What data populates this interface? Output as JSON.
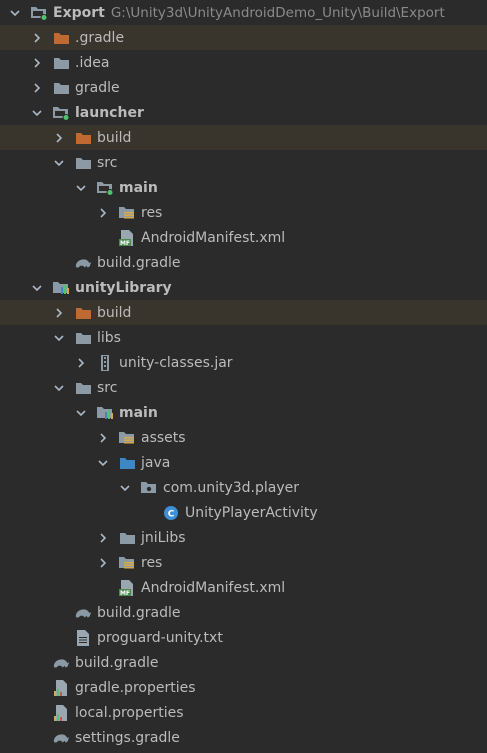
{
  "tree": [
    {
      "label": "Export",
      "path": "G:\\Unity3d\\UnityAndroidDemo_Unity\\Build\\Export",
      "icon": "module-folder-icon",
      "expanded": true,
      "depth": 0,
      "bold": true
    },
    {
      "label": ".gradle",
      "icon": "excluded-folder-icon",
      "expanded": false,
      "depth": 1,
      "highlight": true
    },
    {
      "label": ".idea",
      "icon": "folder-icon",
      "expanded": false,
      "depth": 1
    },
    {
      "label": "gradle",
      "icon": "folder-icon",
      "expanded": false,
      "depth": 1
    },
    {
      "label": "launcher",
      "icon": "module-folder-icon",
      "expanded": true,
      "depth": 1,
      "bold": true
    },
    {
      "label": "build",
      "icon": "excluded-folder-icon",
      "expanded": false,
      "depth": 2,
      "highlight": true
    },
    {
      "label": "src",
      "icon": "folder-icon",
      "expanded": true,
      "depth": 2
    },
    {
      "label": "main",
      "icon": "module-folder-icon",
      "expanded": true,
      "depth": 3,
      "bold": true
    },
    {
      "label": "res",
      "icon": "resources-folder-icon",
      "expanded": false,
      "depth": 4
    },
    {
      "label": "AndroidManifest.xml",
      "icon": "manifest-file-icon",
      "depth": 4,
      "leaf": true
    },
    {
      "label": "build.gradle",
      "icon": "gradle-file-icon",
      "depth": 2,
      "leaf": true
    },
    {
      "label": "unityLibrary",
      "icon": "library-module-folder-icon",
      "expanded": true,
      "depth": 1,
      "bold": true
    },
    {
      "label": "build",
      "icon": "excluded-folder-icon",
      "expanded": false,
      "depth": 2,
      "highlight": true
    },
    {
      "label": "libs",
      "icon": "folder-icon",
      "expanded": true,
      "depth": 2
    },
    {
      "label": "unity-classes.jar",
      "icon": "jar-file-icon",
      "expanded": false,
      "depth": 3
    },
    {
      "label": "src",
      "icon": "folder-icon",
      "expanded": true,
      "depth": 2
    },
    {
      "label": "main",
      "icon": "library-module-folder-icon",
      "expanded": true,
      "depth": 3,
      "bold": true
    },
    {
      "label": "assets",
      "icon": "resources-folder-icon",
      "expanded": false,
      "depth": 4
    },
    {
      "label": "java",
      "icon": "source-folder-icon",
      "expanded": true,
      "depth": 4
    },
    {
      "label": "com.unity3d.player",
      "icon": "package-icon",
      "expanded": true,
      "depth": 5
    },
    {
      "label": "UnityPlayerActivity",
      "icon": "java-class-icon",
      "depth": 6,
      "leaf": true
    },
    {
      "label": "jniLibs",
      "icon": "folder-icon",
      "expanded": false,
      "depth": 4
    },
    {
      "label": "res",
      "icon": "resources-folder-icon",
      "expanded": false,
      "depth": 4
    },
    {
      "label": "AndroidManifest.xml",
      "icon": "manifest-file-icon",
      "depth": 4,
      "leaf": true
    },
    {
      "label": "build.gradle",
      "icon": "gradle-file-icon",
      "depth": 2,
      "leaf": true
    },
    {
      "label": "proguard-unity.txt",
      "icon": "text-file-icon",
      "depth": 2,
      "leaf": true
    },
    {
      "label": "build.gradle",
      "icon": "gradle-file-icon",
      "depth": 1,
      "leaf": true
    },
    {
      "label": "gradle.properties",
      "icon": "properties-file-icon",
      "depth": 1,
      "leaf": true
    },
    {
      "label": "local.properties",
      "icon": "properties-file-icon",
      "depth": 1,
      "leaf": true
    },
    {
      "label": "settings.gradle",
      "icon": "gradle-file-icon",
      "depth": 1,
      "leaf": true
    }
  ],
  "colors": {
    "background": "#2b2b2b",
    "highlight": "#3a352c",
    "folder": "#8c9aa5",
    "excluded_folder": "#c06a33",
    "source_folder": "#3d88c4",
    "module_dot": "#4fc46a",
    "library_bars": "#3d88c4",
    "gradle": "#8a9aa4",
    "java_class": "#3d8fd6",
    "text": "#bbbbbb",
    "path": "#8a8a8a"
  }
}
